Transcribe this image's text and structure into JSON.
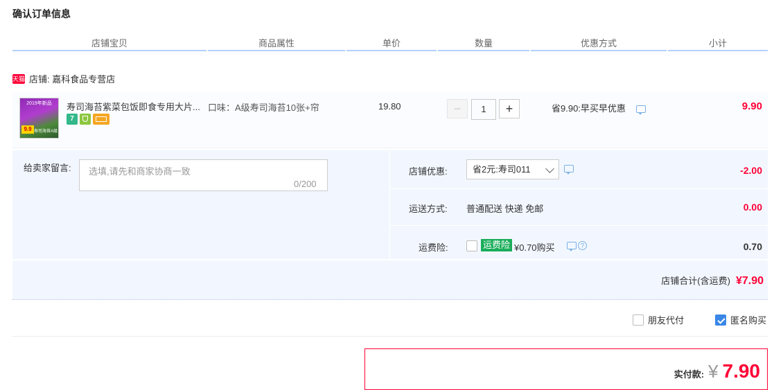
{
  "page_title": "确认订单信息",
  "columns": [
    "店铺宝贝",
    "商品属性",
    "单价",
    "数量",
    "优惠方式",
    "小计"
  ],
  "shop": {
    "badge": "天猫",
    "label": "店铺: 嘉科食品专营店"
  },
  "item": {
    "thumb_tag": "2019年新品",
    "thumb_price": "9.9",
    "thumb_caption": "寿司海苔A级",
    "title": "寿司海苔紫菜包饭即食专用大片...",
    "attribute": "口味：A级寿司海苔10张+帘",
    "unit_price": "19.80",
    "quantity": "1",
    "qty_minus": "−",
    "qty_plus": "+",
    "promo": "省9.90:早买早优惠",
    "subtotal": "9.90",
    "badges": [
      {
        "icon": "seven-day-return-icon",
        "text": "7",
        "color": "#33b88a"
      },
      {
        "icon": "guarantee-icon",
        "text": "",
        "color": "#8cc63f"
      },
      {
        "icon": "credit-card-icon",
        "text": "",
        "color": "#f5a623"
      }
    ]
  },
  "message": {
    "label": "给卖家留言:",
    "placeholder": "选填,请先和商家协商一致",
    "counter": "0/200"
  },
  "shop_coupon": {
    "label": "店铺优惠:",
    "selected": "省2元:寿司011",
    "amount": "-2.00"
  },
  "shipping": {
    "label": "运送方式:",
    "value": "普通配送 快递 免邮",
    "amount": "0.00"
  },
  "insurance": {
    "label": "运费险:",
    "tag": "运费险",
    "text": "¥0.70购买",
    "amount": "0.70",
    "help": "?"
  },
  "shop_total": {
    "label": "店铺合计(含运费)",
    "amount": "¥7.90"
  },
  "options": {
    "friend_pay": "朋友代付",
    "anonymous": "匿名购买"
  },
  "payment": {
    "label": "实付款:",
    "currency": "¥",
    "amount": "7.90"
  },
  "colors": {
    "accent_red": "#ff0036",
    "header_line": "#b2d1ff",
    "panel_bg": "#f2f7ff",
    "check_blue": "#3a87e6",
    "insurance_green": "#1aad5a"
  }
}
